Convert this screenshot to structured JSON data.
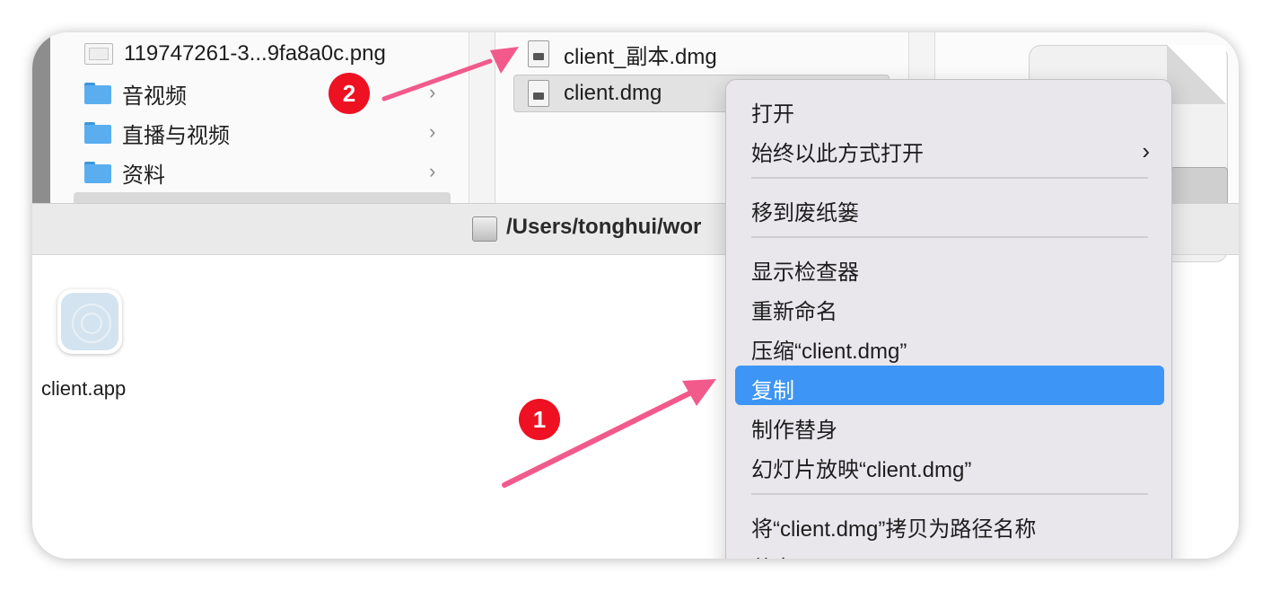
{
  "finder": {
    "sidebar_items": [
      {
        "label": "119747261-3...9fa8a0c.png",
        "icon": "png-file-icon"
      },
      {
        "label": "音视频",
        "icon": "folder-icon"
      },
      {
        "label": "直播与视频",
        "icon": "folder-icon"
      },
      {
        "label": "资料",
        "icon": "folder-icon"
      }
    ],
    "chevron": "›",
    "files": [
      {
        "label": "client_副本.dmg",
        "icon": "dmg-file-icon"
      },
      {
        "label": "client.dmg",
        "icon": "dmg-file-icon"
      }
    ]
  },
  "pathbar": {
    "text": "/Users/tonghui/wor"
  },
  "desktop": {
    "app_label": "client.app",
    "app_icon": "app-placeholder-icon"
  },
  "context_menu": {
    "items": [
      "打开",
      "始终以此方式打开",
      "移到废纸篓",
      "显示检查器",
      "重新命名",
      "压缩“client.dmg”",
      "复制",
      "制作替身",
      "幻灯片放映“client.dmg”",
      "将“client.dmg”拷贝为路径名称",
      "共享"
    ],
    "submenu_arrow": "›",
    "selected_item": "复制"
  },
  "annotations": {
    "badge_1": "1",
    "badge_2": "2",
    "arrow_color": "#f25a8c",
    "badge_color": "#ee1122"
  },
  "colors": {
    "selection_blue": "#3d95f5",
    "menu_bg": "#e9e7ec"
  }
}
